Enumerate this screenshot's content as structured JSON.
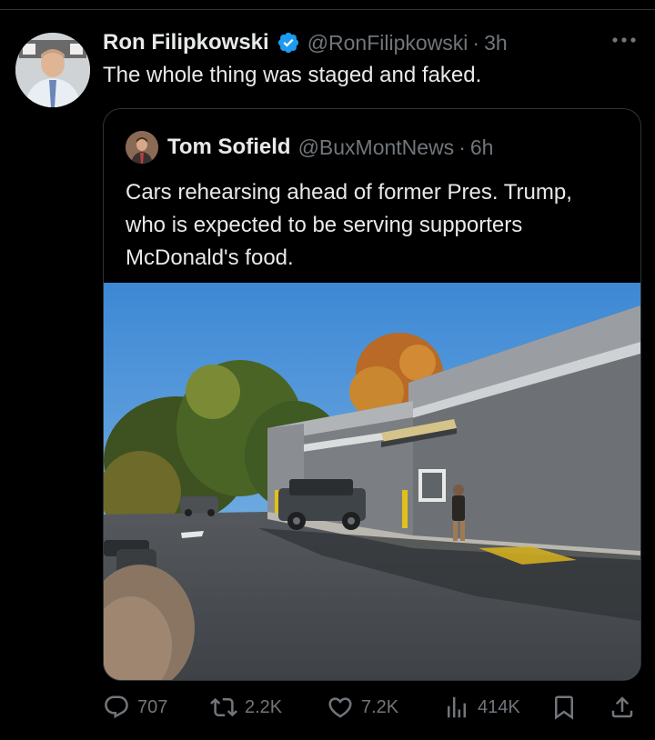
{
  "tweet": {
    "author_name": "Ron Filipkowski",
    "handle": "@RonFilipkowski",
    "time": "3h",
    "text": "The whole thing was staged and faked.",
    "verified": true
  },
  "quote": {
    "author_name": "Tom Sofield",
    "handle": "@BuxMontNews",
    "time": "6h",
    "text": "Cars rehearsing ahead of former Pres. Trump, who is expected to be serving supporters McDonald's food."
  },
  "actions": {
    "replies": "707",
    "reposts": "2.2K",
    "likes": "7.2K",
    "views": "414K"
  },
  "colors": {
    "background": "#000000",
    "text": "#e7e9ea",
    "secondary": "#71767b",
    "verified_badge": "#1d9bf0"
  }
}
